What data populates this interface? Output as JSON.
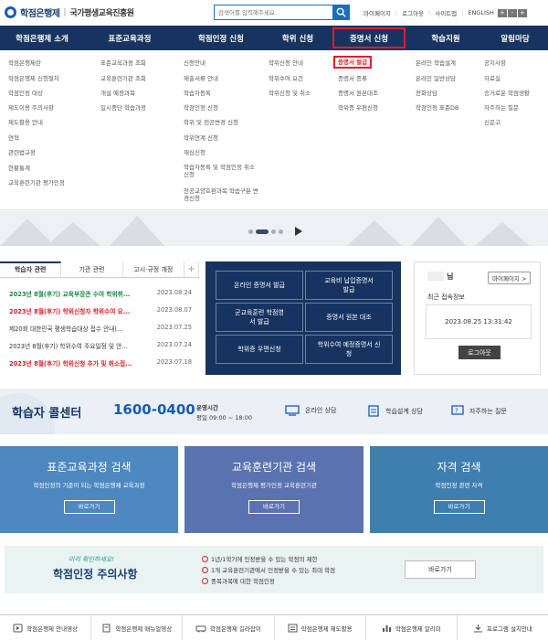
{
  "header": {
    "logo_text": "학점은행제",
    "logo_sep": "|",
    "org_name": "국가평생교육진흥원",
    "search_placeholder": "검색어를 입력해주세요.",
    "links": [
      "마이페이지",
      "로그아웃",
      "사이트맵",
      "ENGLISH"
    ],
    "size_buttons": [
      "+",
      "-",
      "+"
    ]
  },
  "nav": [
    "학점은행제 소개",
    "표준교육과정",
    "학점인정 신청",
    "학위 신청",
    "증명서 신청",
    "학습지원",
    "알림마당"
  ],
  "mega_menu": {
    "col1": [
      "학점은행제란",
      "학점은행제 신청절차",
      "학점인정 대상",
      "제도이용 주의사항",
      "제도활용 안내",
      "연혁",
      "관련법규정",
      "현황통계",
      "교육훈련기관 평가인정"
    ],
    "col2": [
      "표준교육과정 조회",
      "교육훈련기관 조회",
      "개설 예정과목",
      "일시중단 학습과정"
    ],
    "col3": [
      "신청안내",
      "제출서류 안내",
      "학습자등록",
      "학점인정 신청",
      "학위 및 전공변경 신청",
      "학위연계 신청",
      "재심신청",
      "학습자등록 및 학점인정 취소 신청",
      "전공교양호환과목 학습구분 변경신청"
    ],
    "col4": [
      "학위신청 안내",
      "학위수여 요건",
      "학위신청 및 취소"
    ],
    "col5": [
      "증명서 발급",
      "증명서 종류",
      "증명서 원본대조",
      "학위증 우편신청"
    ],
    "col6": [
      "온라인 학습설계",
      "온라인 일반상담",
      "전화상담",
      "학점인정 표준DB"
    ],
    "col7": [
      "공지사항",
      "자료실",
      "승거로운 학점생활",
      "자주하는 질문",
      "신문고"
    ]
  },
  "board": {
    "tabs": [
      "학습자 관련",
      "기관 관련",
      "고시·규정 개정",
      "+"
    ],
    "notices": [
      {
        "title": "2023년 8월(후기) 교육부장관 수여 학위취...",
        "date": "2023.08.24",
        "color": "#1a8a3a"
      },
      {
        "title": "2023년 8월(후기) 학위신청자 학위수여 요...",
        "date": "2023.08.07",
        "color": "#d8202a"
      },
      {
        "title": "제20회 대한민국 평생학습대상 접수 안내(...",
        "date": "2023.07.25",
        "color": "#333333"
      },
      {
        "title": "2023년 8월(후기) 학위수여 주요일정 및 안...",
        "date": "2023.07.24",
        "color": "#333333"
      },
      {
        "title": "2023년 8월(후기) 학위신청 추가 및 취소접...",
        "date": "2023.07.18",
        "color": "#d8202a"
      }
    ]
  },
  "cert_buttons": [
    "온라인 증명서 발급",
    "교육비 납입증명서 발급",
    "군교육훈련 학점영서 발급",
    "증명서 원본 대조",
    "학위증 우편신청",
    "학위수여 예정증명서 신청"
  ],
  "user": {
    "name": "님",
    "mypage": "마이페이지 >",
    "last_login_label": "최근 접속정보",
    "last_login": "2023.08.25 13:31:42",
    "logout": "로그아웃"
  },
  "call_center": {
    "label": "학습자 콜센터",
    "number": "1600-0400",
    "hours_label": "운영시간",
    "hours": "평일 09:00 ~ 18:00",
    "links": [
      "온라인 상담",
      "학습설계 상담",
      "자주하는 질문"
    ]
  },
  "search_banners": [
    {
      "title": "표준교육과정 검색",
      "desc": "학점인정의 기준이 되는 학점은행제 교육과정",
      "btn": "바로가기",
      "color": "#4d88bf"
    },
    {
      "title": "교육훈련기관 검색",
      "desc": "학점은행제 평가인정 교육훈련기관",
      "btn": "바로가기",
      "color": "#5a73b0"
    },
    {
      "title": "자격 검색",
      "desc": "학점인정 관련 자격",
      "btn": "바로가기",
      "color": "#3f7fb0"
    }
  ],
  "caution": {
    "sub": "미리 확인하세요!",
    "title": "학점인정 주의사항",
    "items": [
      "1년/1학기에 인정받을 수 있는 학점의 제한",
      "1개 교육훈련기관에서 인정받을 수 있는 최대 학점",
      "중복과목에 대한 학점인정"
    ],
    "btn": "바로가기"
  },
  "footer": [
    "학점은행제 안내영상",
    "학점은행제 매뉴얼영상",
    "학점은행제 길라잡이",
    "학점은행제 제도활용",
    "학점은행제 알리미",
    "프로그램 설치안내"
  ]
}
